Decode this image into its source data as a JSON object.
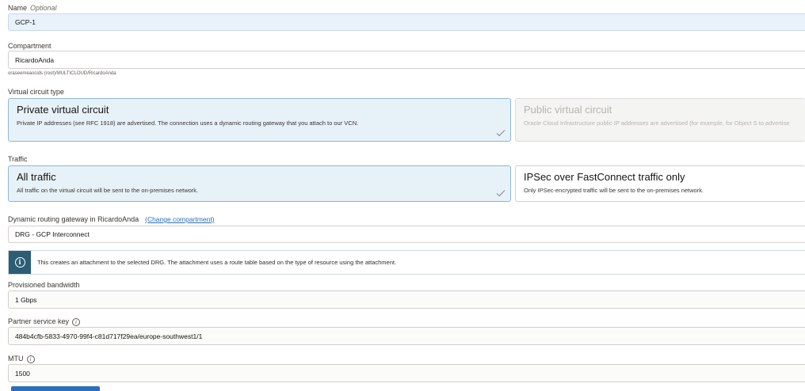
{
  "name": {
    "label": "Name",
    "optional": "Optional",
    "value": "GCP-1"
  },
  "compartment": {
    "label": "Compartment",
    "value": "RicardoAnda",
    "path": "oraseemeaocids (root)/MULTICLOUD/RicardoAnda"
  },
  "circuit_type": {
    "label": "Virtual circuit type",
    "options": [
      {
        "title": "Private virtual circuit",
        "desc": "Private IP addresses (see RFC 1918) are advertised. The connection uses a dynamic routing gateway that you attach to our VCN.",
        "selected": true
      },
      {
        "title": "Public virtual circuit",
        "desc": "Oracle Cloud Infrastructure public IP addresses are advertised (for example, for Object S to advertise",
        "disabled": true
      }
    ]
  },
  "traffic": {
    "label": "Traffic",
    "options": [
      {
        "title": "All traffic",
        "desc": "All traffic on the virtual circuit will be sent to the on-premises network.",
        "selected": true
      },
      {
        "title": "IPSec over FastConnect traffic only",
        "desc": "Only IPSec-encrypted traffic will be sent to the on-premises network."
      }
    ]
  },
  "drg": {
    "label": "Dynamic routing gateway in",
    "compartment": "RicardoAnda",
    "change_link": "(Change compartment)",
    "value": "DRG - GCP Interconnect"
  },
  "info_banner": {
    "icon": "info-icon",
    "message": "This creates an attachment to the selected DRG. The attachment uses a route table based on the type of resource using the attachment."
  },
  "bandwidth": {
    "label": "Provisioned bandwidth",
    "value": "1 Gbps"
  },
  "partner_key": {
    "label": "Partner service key",
    "value": "484b4cfb-5833-4970-99f4-c81d717f29ea/europe-southwest1/1"
  },
  "mtu": {
    "label": "MTU",
    "value": "1500"
  },
  "colors": {
    "accent": "#2c5d75",
    "selected_bg": "#e7f1f8",
    "link": "#2a6fb8"
  }
}
